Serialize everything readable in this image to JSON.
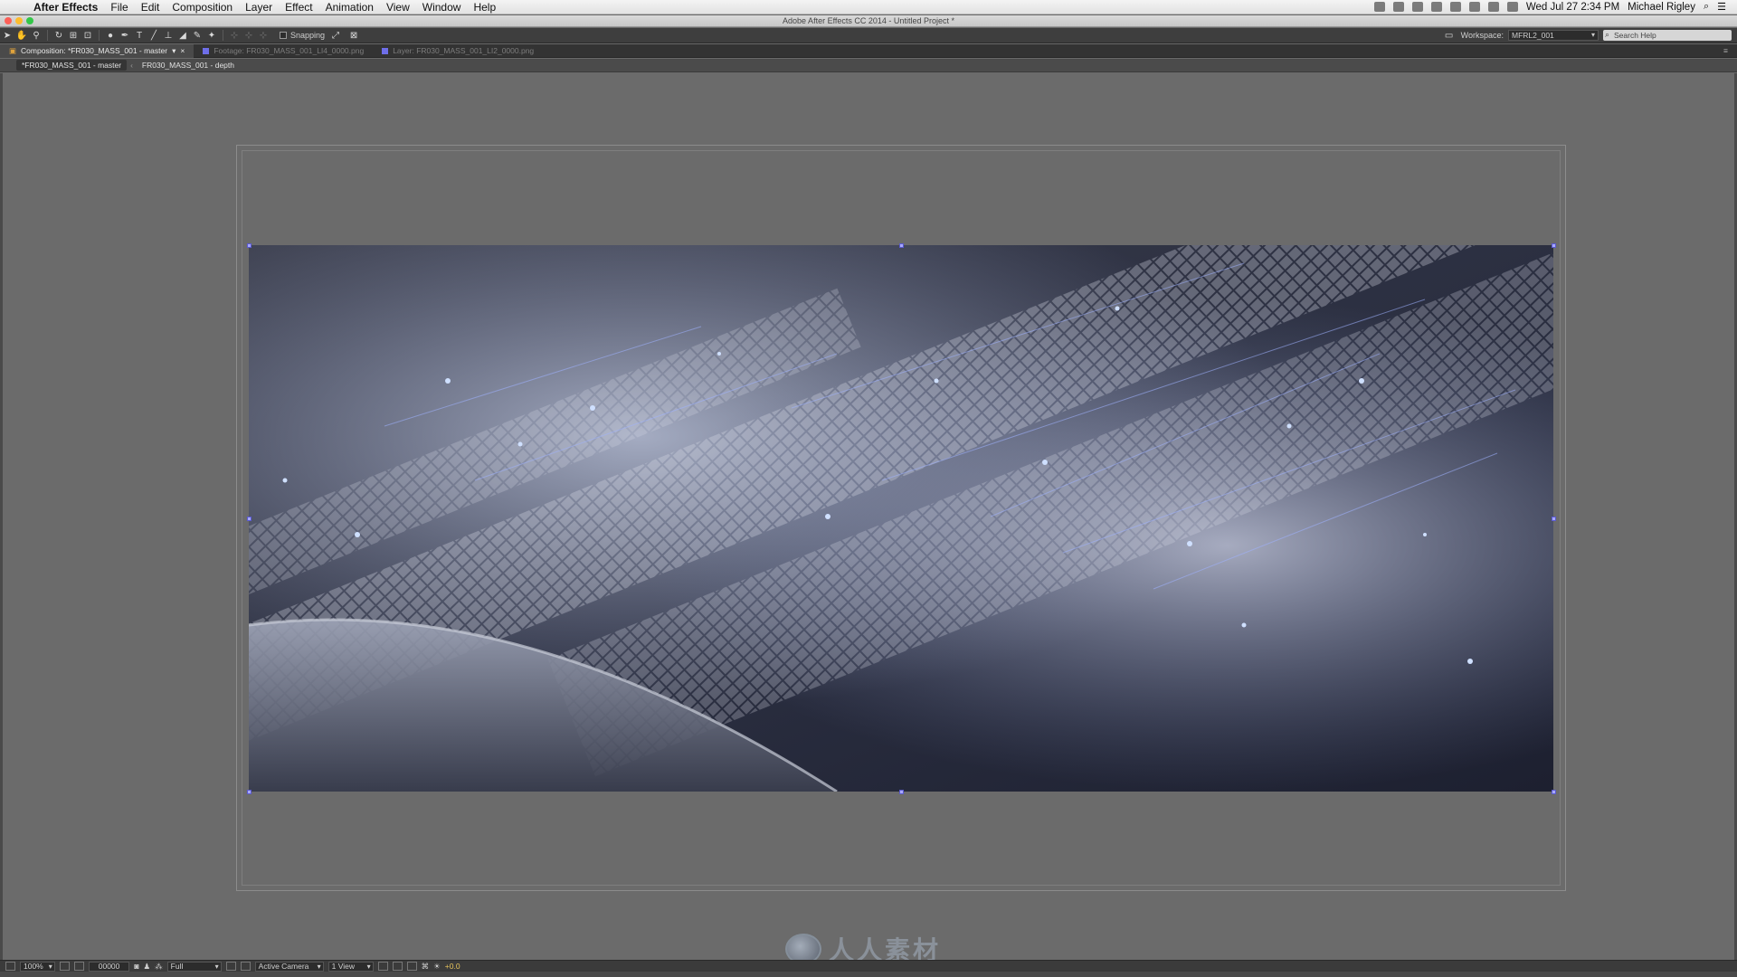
{
  "menubar": {
    "app_name": "After Effects",
    "menus": [
      "File",
      "Edit",
      "Composition",
      "Layer",
      "Effect",
      "Animation",
      "View",
      "Window",
      "Help"
    ],
    "clock": "Wed Jul 27  2:34 PM",
    "user": "Michael Rigley"
  },
  "window": {
    "title": "Adobe After Effects CC 2014 - Untitled Project *"
  },
  "toolbar": {
    "snapping_label": "Snapping",
    "workspace_label": "Workspace:",
    "workspace_value": "MFRL2_001",
    "search_placeholder": "Search Help"
  },
  "panel_tabs": {
    "composition": "Composition: *FR030_MASS_001 - master",
    "footage": "Footage: FR030_MASS_001_LI4_0000.png",
    "layer": "Layer: FR030_MASS_001_LI2_0000.png"
  },
  "breadcrumb": {
    "items": [
      "*FR030_MASS_001 - master",
      "FR030_MASS_001 - depth"
    ]
  },
  "viewer_bar": {
    "magnification": "100%",
    "timecode": "00000",
    "resolution": "Full",
    "camera": "Active Camera",
    "views": "1 View",
    "exposure": "+0.0"
  },
  "watermark": {
    "text": "人人素材"
  },
  "colors": {
    "accent_purple": "#6e6ee8",
    "viewer_bg": "#6b6b6b",
    "exposure_yellow": "#e7c45b"
  }
}
